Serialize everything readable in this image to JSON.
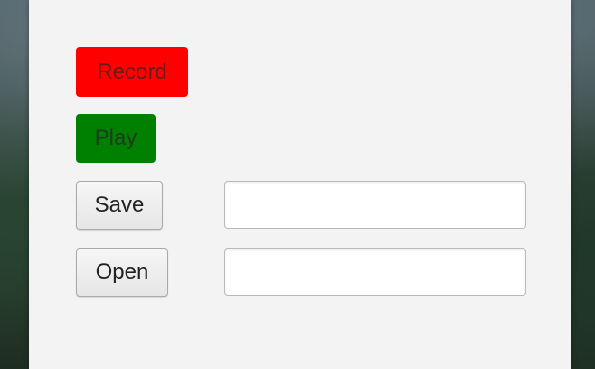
{
  "colors": {
    "record": "#ff0000",
    "play": "#008000",
    "window_bg": "#f3f3f3"
  },
  "buttons": {
    "record_label": "Record",
    "play_label": "Play",
    "save_label": "Save",
    "open_label": "Open"
  },
  "fields": {
    "save_path_value": "",
    "open_path_value": ""
  }
}
